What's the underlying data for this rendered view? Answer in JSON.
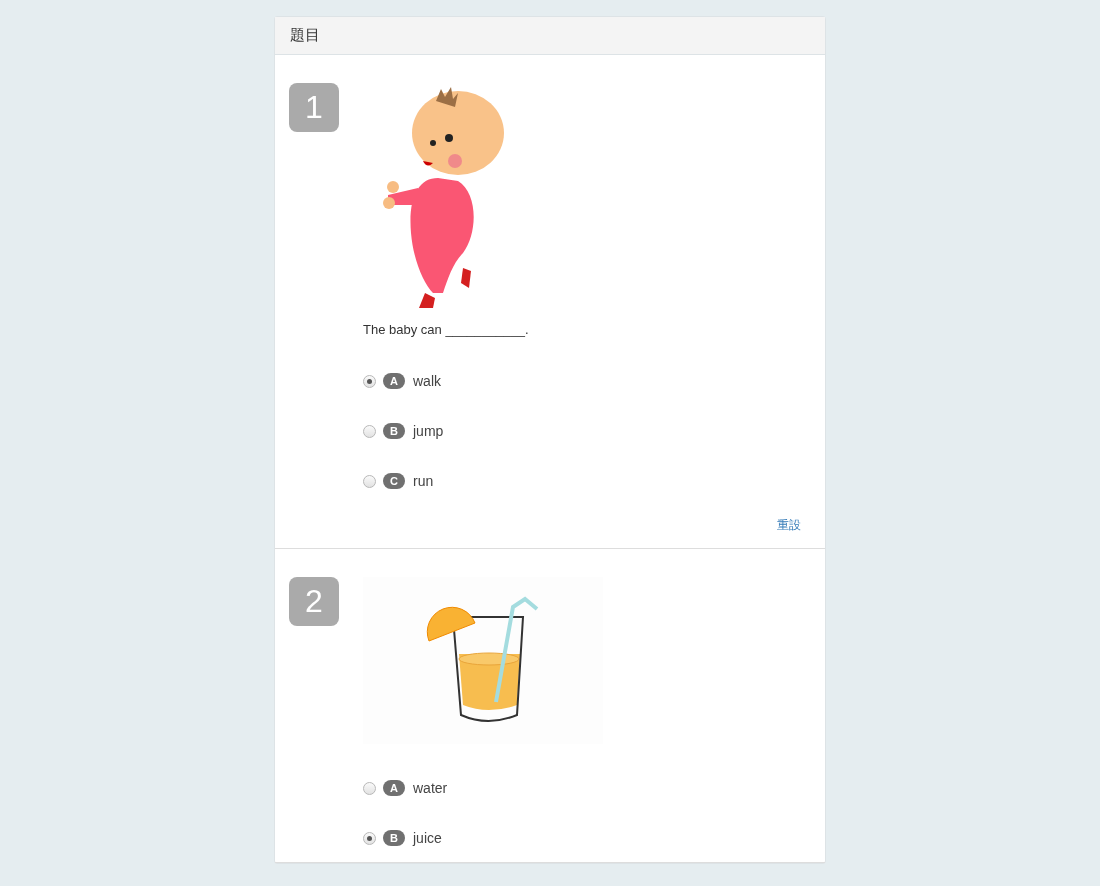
{
  "panel": {
    "title": "題目"
  },
  "questions": [
    {
      "number": "1",
      "kind": "baby",
      "prompt": "The baby can ___________.",
      "reset": "重設",
      "options": [
        {
          "letter": "A",
          "text": "walk",
          "selected": true
        },
        {
          "letter": "B",
          "text": "jump",
          "selected": false
        },
        {
          "letter": "C",
          "text": "run",
          "selected": false
        }
      ]
    },
    {
      "number": "2",
      "kind": "juice",
      "options": [
        {
          "letter": "A",
          "text": "water",
          "selected": false
        },
        {
          "letter": "B",
          "text": "juice",
          "selected": true
        }
      ]
    }
  ]
}
